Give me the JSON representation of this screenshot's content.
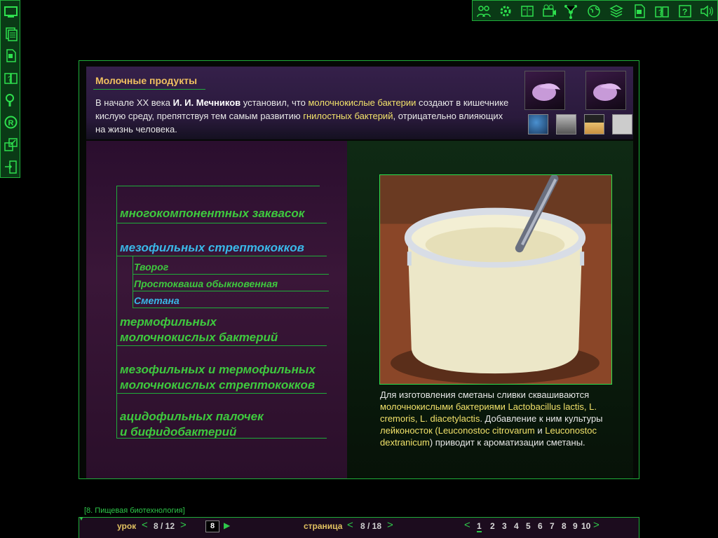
{
  "left_toolbar": {
    "icons": [
      "monitor-icon",
      "pages-icon",
      "document-icon",
      "book-question-icon",
      "magnifier-icon",
      "registered-icon",
      "shrink-icon",
      "exit-icon"
    ]
  },
  "top_toolbar": {
    "icons": [
      "team-icon",
      "settings-gear-icon",
      "notebook-icon",
      "film-icon",
      "molecule-icon",
      "globe-icon",
      "stack-icon",
      "document-icon",
      "book-question-icon",
      "help-icon",
      "sound-icon"
    ]
  },
  "header": {
    "title": "Молочные продукты",
    "intro_1": "В начале XX века ",
    "intro_name": "И. И. Мечников",
    "intro_2": " установил, что ",
    "intro_link1": "молочнокислые бактерии",
    "intro_3": " создают в кишечнике кислую среду, препятствуя тем самым развитию ",
    "intro_link2": "гнилостных бактерий",
    "intro_4": ", отрицательно влияющих на жизнь человека.",
    "thumbs": [
      "globe-thumb",
      "portrait-thumb",
      "book-thumb",
      "camera-thumb"
    ]
  },
  "categories": {
    "c1": "многокомпонентных заквасок",
    "c2": "мезофильных стрептококков",
    "sub1": "Творог",
    "sub2": "Простокваша обыкновенная",
    "sub3": "Сметана",
    "c3_l1": "термофильных",
    "c3_l2": "молочнокислых бактерий",
    "c4_l1": "мезофильных и термофильных",
    "c4_l2": "молочнокислых стрептококков",
    "c5_l1": "ацидофильных палочек",
    "c5_l2": "и бифидобактерий"
  },
  "caption": {
    "p1": "Для изготовления сметаны сливки сквашиваются ",
    "p1y": "молочнокислыми бактериями",
    "p2": " Lactobacillus lactis, L. cremoris, L. diacetylactis",
    "p3": ". Добавление к ним культуры ",
    "p3y": "лейконосток",
    "p4": " (Leuconostoc citrovarum",
    "p5": " и ",
    "p6": "Leuconostoc dextranicum",
    "p7": ") приводит к ароматизации сметаны."
  },
  "footer": {
    "section": "[8. Пищевая биотехнология]",
    "lesson_label": "урок",
    "lesson_value": "8 / 12",
    "lesson_input": "8",
    "page_label": "страница",
    "page_value": "8 / 18",
    "pages": [
      "1",
      "2",
      "3",
      "4",
      "5",
      "6",
      "7",
      "8",
      "9",
      "10"
    ]
  }
}
